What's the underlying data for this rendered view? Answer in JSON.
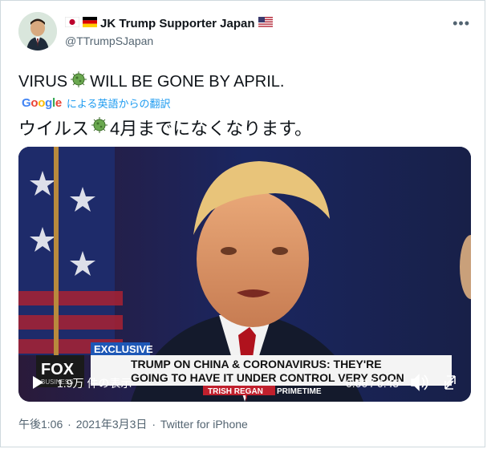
{
  "author": {
    "display_name": "JK Trump Supporter Japan",
    "handle": "@TTrumpSJapan",
    "flags": [
      "japan-flag-icon",
      "germany-flag-icon",
      "usa-flag-icon"
    ]
  },
  "tweet": {
    "text_before": "VIRUS",
    "text_after": "WILL BE GONE BY APRIL.",
    "google_logo": "Google",
    "translated_label": "による英語からの翻訳",
    "translation_before": "ウイルス",
    "translation_after": " 4月までになくなります。",
    "emoji": "virus-emoji-icon"
  },
  "video": {
    "views": "1.9万 件の表示",
    "time": "0:00 / 0:45",
    "banner_tag": "EXCLUSIVE",
    "headline_1": "TRUMP ON CHINA & CORONAVIRUS: THEY'RE",
    "headline_2": "GOING TO HAVE IT UNDER CONTROL VERY SOON",
    "anchor": "TRISH REGAN",
    "show": "PRIMETIME",
    "network": "FOX",
    "network_sub": "BUSINESS"
  },
  "footer": {
    "time": "午後1:06",
    "sep": "·",
    "date": "2021年3月3日",
    "sep2": "·",
    "source": "Twitter for iPhone"
  }
}
